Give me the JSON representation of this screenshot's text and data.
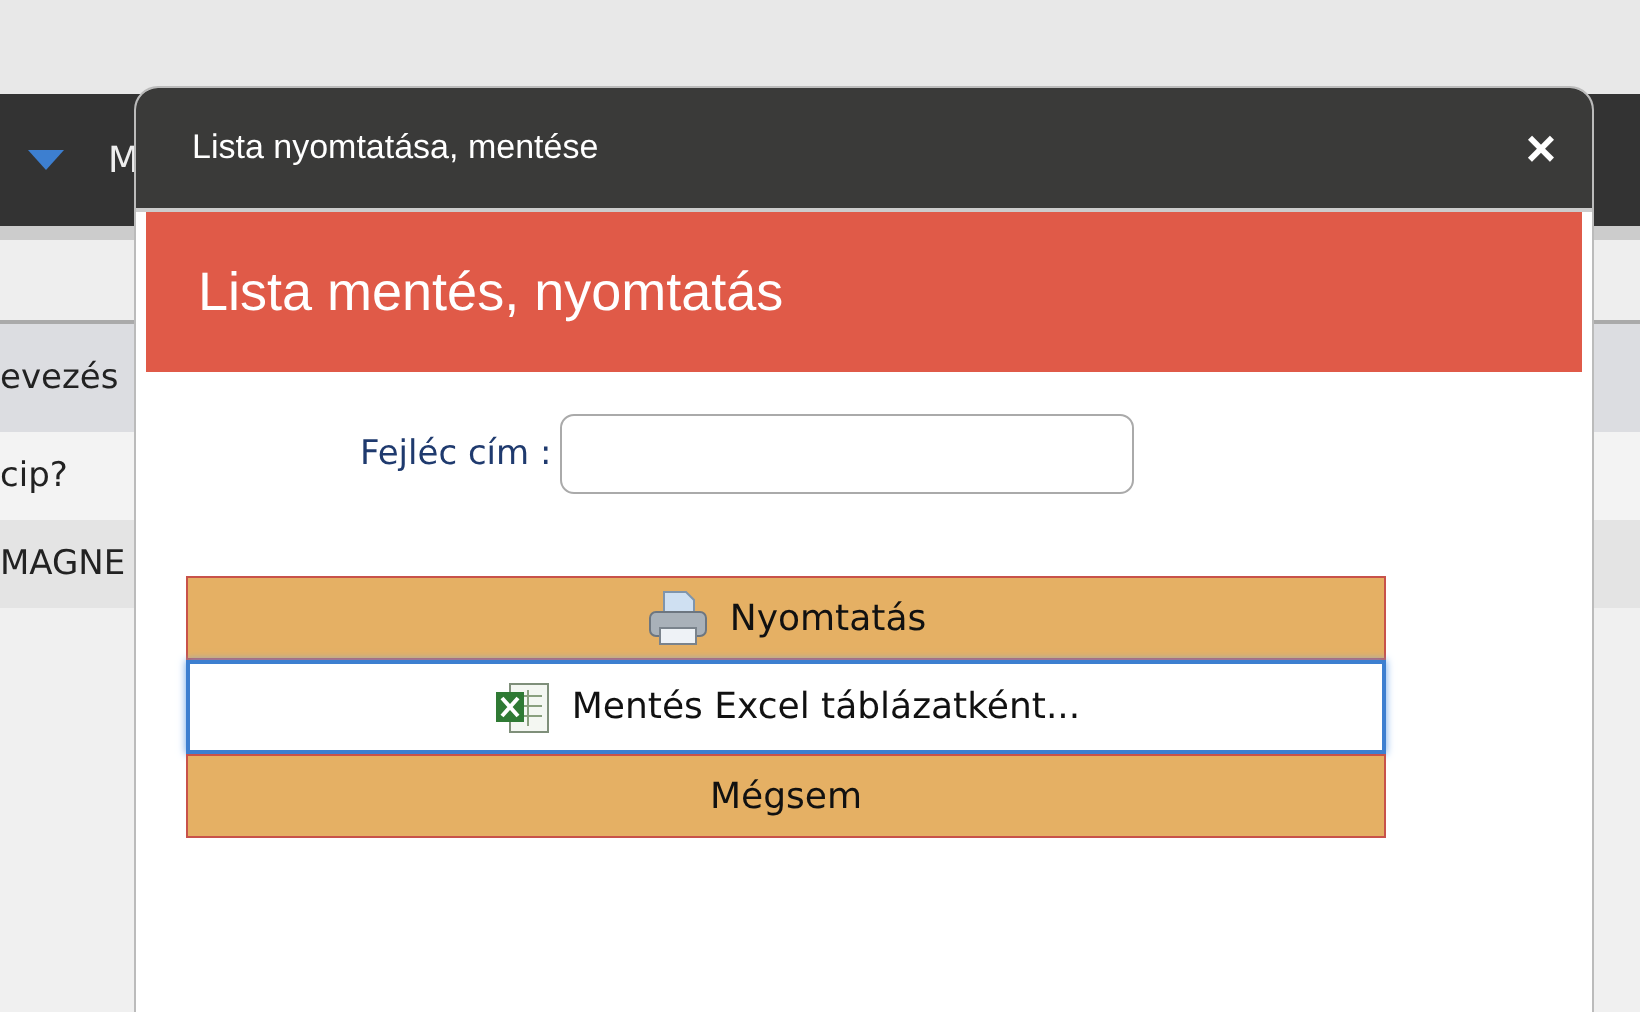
{
  "background": {
    "nav_text": "M",
    "table": {
      "header": "evezés",
      "rows": [
        "cip?",
        "MAGNE"
      ]
    }
  },
  "dialog": {
    "title": "Lista nyomtatása, mentése",
    "close": "×",
    "heading": "Lista mentés, nyomtatás",
    "field": {
      "label": "Fejléc cím :"
    },
    "buttons": [
      {
        "kind": "print",
        "label": "Nyomtatás",
        "focused": false
      },
      {
        "kind": "excel",
        "label": "Mentés Excel táblázatként...",
        "focused": true
      },
      {
        "kind": "plain",
        "label": "Mégsem",
        "focused": false
      }
    ]
  }
}
